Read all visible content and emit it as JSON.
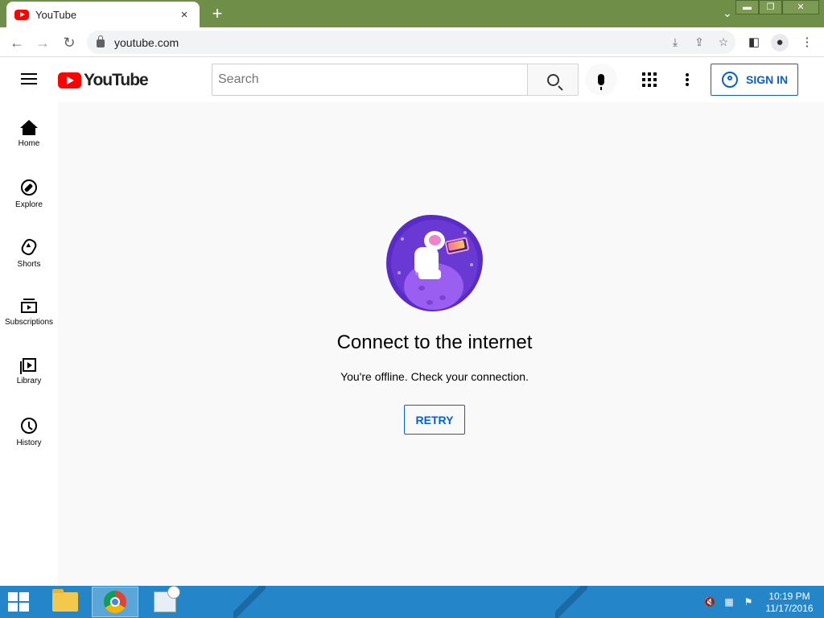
{
  "browser": {
    "tab_title": "YouTube",
    "tab_close": "×",
    "new_tab": "+",
    "url": "youtube.com",
    "window_chevron": "⌄",
    "win_min": "▬",
    "win_max": "❐",
    "win_close": "✕"
  },
  "youtube": {
    "logo_text": "YouTube",
    "search_placeholder": "Search",
    "sign_in_label": "SIGN IN",
    "sidebar": [
      {
        "label": "Home",
        "icon": "home-icon"
      },
      {
        "label": "Explore",
        "icon": "explore-icon"
      },
      {
        "label": "Shorts",
        "icon": "shorts-icon"
      },
      {
        "label": "Subscriptions",
        "icon": "subscriptions-icon"
      },
      {
        "label": "Library",
        "icon": "library-icon"
      },
      {
        "label": "History",
        "icon": "history-icon"
      }
    ],
    "offline": {
      "headline": "Connect to the internet",
      "message": "You're offline. Check your connection.",
      "retry_label": "RETRY"
    }
  },
  "taskbar": {
    "time": "10:19 PM",
    "date": "11/17/2016"
  },
  "colors": {
    "accent_blue": "#065fd4",
    "youtube_red": "#ff0000",
    "titlebar_green": "#6f8f48",
    "taskbar_blue": "#2485c8"
  }
}
